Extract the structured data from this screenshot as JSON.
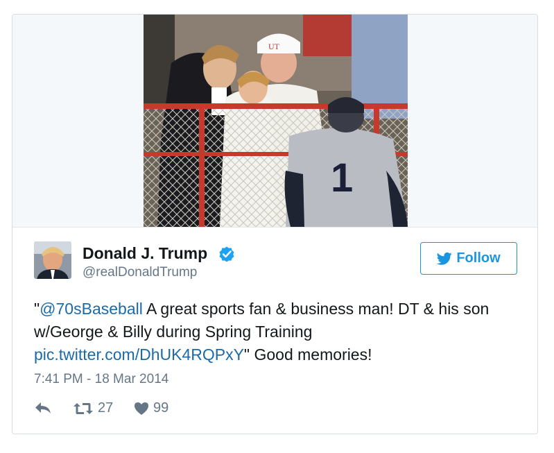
{
  "tweet": {
    "author_name": "Donald J. Trump",
    "author_handle": "@realDonaldTrump",
    "follow_label": "Follow",
    "text_quote_open": "\"",
    "text_mention": "@70sBaseball",
    "text_body": " A great sports fan & business man! DT & his son w/George & Billy during Spring Training ",
    "text_link": "pic.twitter.com/DhUK4RQPxY",
    "text_tail": "\" Good memories!",
    "timestamp": "7:41 PM - 18 Mar 2014",
    "retweet_count": "27",
    "like_count": "99"
  },
  "icons": {
    "reply": "reply-icon",
    "retweet": "retweet-icon",
    "like": "heart-icon",
    "verified": "verified-badge-icon",
    "bird": "twitter-bird-icon"
  },
  "colors": {
    "accent": "#1b95e0",
    "link": "#1b6aa8",
    "muted": "#657786",
    "text": "#14171a",
    "border": "#d6dde3"
  }
}
